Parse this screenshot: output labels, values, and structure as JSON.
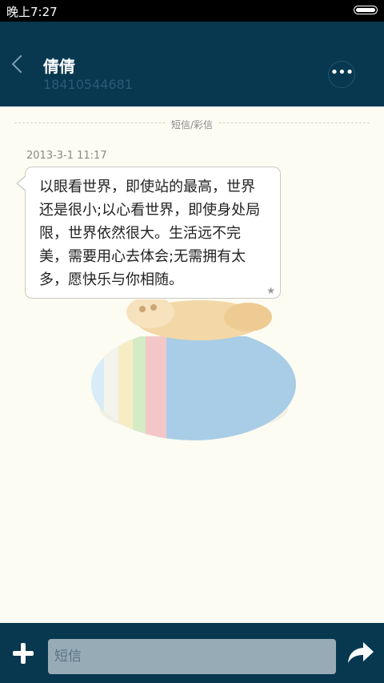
{
  "status_bar": {
    "time": "晚上7:27"
  },
  "header": {
    "contact_name": "倩倩",
    "contact_number": "18410544681",
    "more_label": "•••"
  },
  "thread": {
    "divider_label": "短信/彩信",
    "messages": [
      {
        "timestamp": "2013-3-1 11:17",
        "text": "以眼看世界，即使站的最高，世界还是很小;以心看世界，即使身处局限，世界依然很大。生活远不完美，需要用心去体会;无需拥有太多，愿快乐与你相随。",
        "starred_icon": "star-icon"
      }
    ]
  },
  "composer": {
    "placeholder": "短信"
  },
  "colors": {
    "header_bg": "#073850",
    "background": "#fdfcf2",
    "bubble_bg": "#ffffff",
    "input_bg": "#97abb7"
  }
}
